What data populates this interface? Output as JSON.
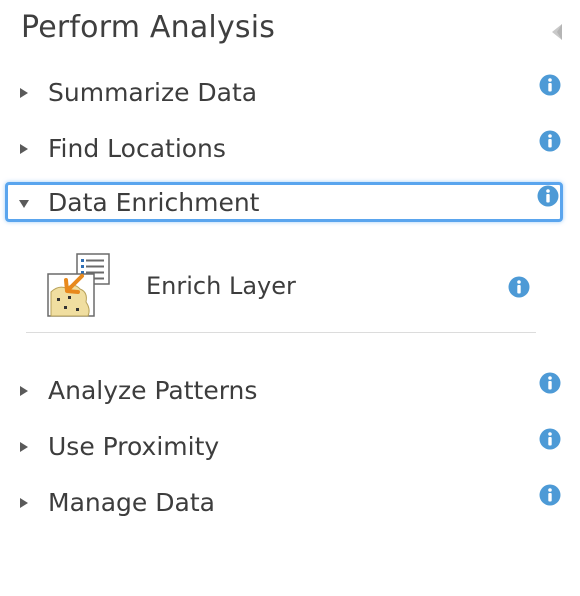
{
  "panel": {
    "title": "Perform Analysis",
    "collapse_icon": "triangle-left-icon"
  },
  "categories": [
    {
      "label": "Summarize Data",
      "expanded": false,
      "icon": "chevron-right-icon",
      "info_icon": "info-icon"
    },
    {
      "label": "Find Locations",
      "expanded": false,
      "icon": "chevron-right-icon",
      "info_icon": "info-icon"
    },
    {
      "label": "Data Enrichment",
      "expanded": true,
      "icon": "chevron-down-icon",
      "info_icon": "info-icon"
    },
    {
      "label": "Analyze Patterns",
      "expanded": false,
      "icon": "chevron-right-icon",
      "info_icon": "info-icon"
    },
    {
      "label": "Use Proximity",
      "expanded": false,
      "icon": "chevron-right-icon",
      "info_icon": "info-icon"
    },
    {
      "label": "Manage Data",
      "expanded": false,
      "icon": "chevron-right-icon",
      "info_icon": "info-icon"
    }
  ],
  "tools": [
    {
      "label": "Enrich Layer",
      "icon": "enrich-layer-icon",
      "info_icon": "info-icon"
    }
  ],
  "colors": {
    "accent": "#5aa5ee",
    "info": "#4d9ad6",
    "text": "#3d3d3d",
    "chevron": "#5a5a5a"
  }
}
